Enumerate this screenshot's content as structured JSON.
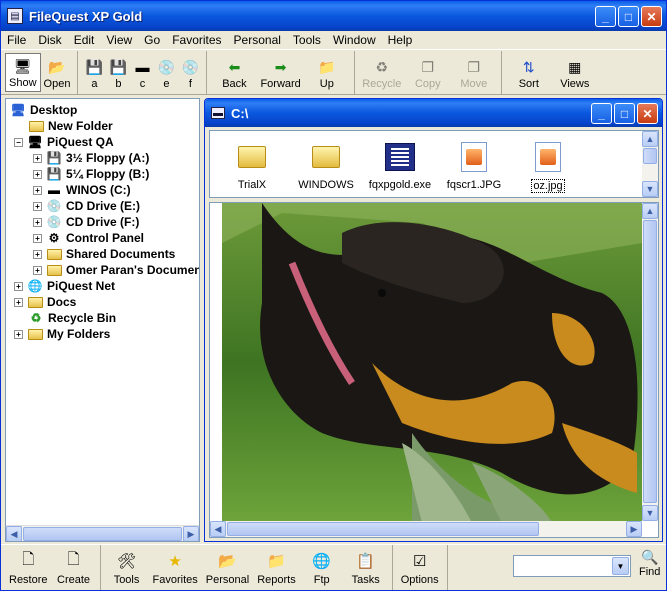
{
  "window": {
    "title": "FileQuest XP Gold"
  },
  "menu": [
    "File",
    "Disk",
    "Edit",
    "View",
    "Go",
    "Favorites",
    "Personal",
    "Tools",
    "Window",
    "Help"
  ],
  "toolbar": {
    "view_buttons": [
      "Show",
      "Open"
    ],
    "drive_buttons": [
      "a",
      "b",
      "c",
      "e",
      "f"
    ],
    "nav_buttons": [
      "Back",
      "Forward",
      "Up"
    ],
    "edit_buttons": [
      "Recycle",
      "Copy",
      "Move"
    ],
    "layout_buttons": [
      "Sort",
      "Views"
    ]
  },
  "tree": {
    "items": [
      {
        "label": "Desktop"
      },
      {
        "label": "New Folder"
      },
      {
        "label": "PiQuest QA"
      },
      {
        "label": "3½ Floppy (A:)"
      },
      {
        "label": "5¼ Floppy (B:)"
      },
      {
        "label": "WINOS (C:)"
      },
      {
        "label": "CD Drive (E:)"
      },
      {
        "label": "CD Drive (F:)"
      },
      {
        "label": "Control Panel"
      },
      {
        "label": "Shared Documents"
      },
      {
        "label": "Omer Paran's Documents"
      },
      {
        "label": "PiQuest  Net"
      },
      {
        "label": "Docs"
      },
      {
        "label": "Recycle Bin"
      },
      {
        "label": "My Folders"
      }
    ]
  },
  "child": {
    "title": "C:\\",
    "files": [
      "TrialX",
      "WINDOWS",
      "fqxpgold.exe",
      "fqscr1.JPG",
      "oz.jpg"
    ]
  },
  "bottom": {
    "buttons": [
      "Restore",
      "Create",
      "Tools",
      "Favorites",
      "Personal",
      "Reports",
      "Ftp",
      "Tasks",
      "Options"
    ],
    "find_label": "Find"
  }
}
